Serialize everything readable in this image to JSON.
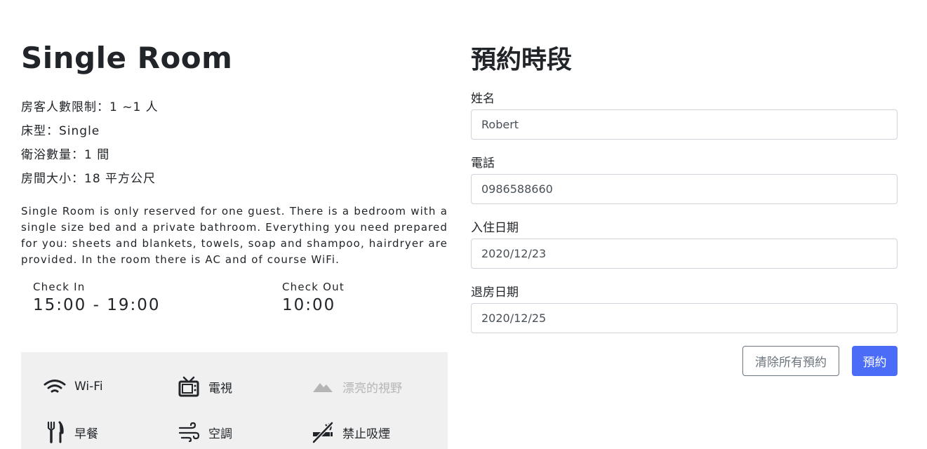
{
  "room": {
    "title": "Single Room",
    "specs": [
      "房客人數限制：1 ~1 人",
      "床型：Single",
      "衛浴數量：1 間",
      "房間大小：18 平方公尺"
    ],
    "description": "Single Room is only reserved for one guest. There is a bedroom with a single size bed and a private bathroom. Everything you need prepared for you: sheets and blankets, towels, soap and shampoo, hairdryer are provided. In the room there is AC and of course WiFi.",
    "check_in": {
      "label": "Check In",
      "value": "15:00 - 19:00"
    },
    "check_out": {
      "label": "Check Out",
      "value": "10:00"
    }
  },
  "amenities": [
    {
      "label": "Wi-Fi",
      "icon": "wifi-icon",
      "available": true
    },
    {
      "label": "電視",
      "icon": "tv-icon",
      "available": true
    },
    {
      "label": "漂亮的視野",
      "icon": "mountain-view-icon",
      "available": false
    },
    {
      "label": "早餐",
      "icon": "fork-knife-icon",
      "available": true
    },
    {
      "label": "空調",
      "icon": "wind-icon",
      "available": true
    },
    {
      "label": "禁止吸煙",
      "icon": "no-smoking-icon",
      "available": true
    }
  ],
  "form": {
    "title": "預約時段",
    "name": {
      "label": "姓名",
      "value": "Robert"
    },
    "phone": {
      "label": "電話",
      "value": "0986588660"
    },
    "check_in_date": {
      "label": "入住日期",
      "value": "2020/12/23"
    },
    "check_out_date": {
      "label": "退房日期",
      "value": "2020/12/25"
    },
    "clear_button": "清除所有預約",
    "submit_button": "預約"
  },
  "colors": {
    "primary": "#4a6cf7",
    "amenity_bg": "#f0f0f0",
    "disabled": "#b5b5b5"
  }
}
